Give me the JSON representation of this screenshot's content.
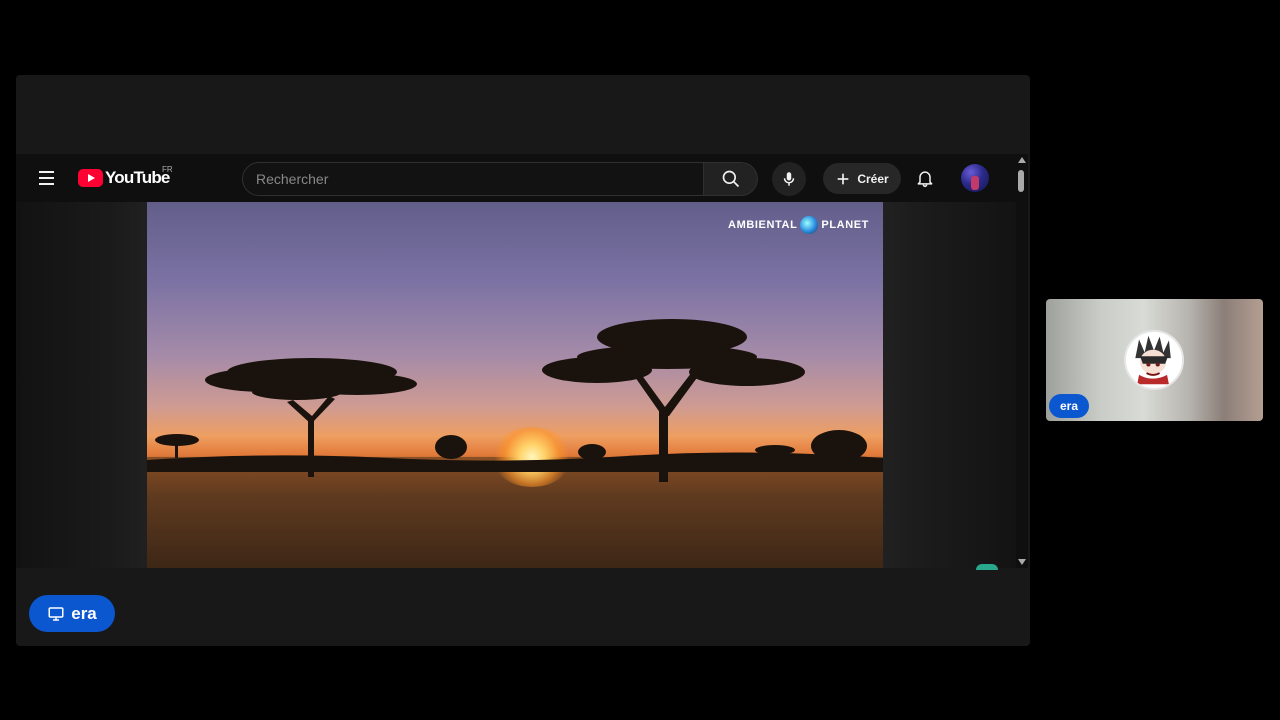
{
  "youtube": {
    "logo_text": "YouTube",
    "region_code": "FR",
    "search": {
      "placeholder": "Rechercher",
      "value": ""
    },
    "create_label": "Créer",
    "icons": {
      "menu": "hamburger-menu-icon",
      "search": "search-icon",
      "mic": "microphone-icon",
      "create": "plus-icon",
      "notifications": "bell-icon"
    },
    "video": {
      "channel_watermark_left": "AMBIENTAL",
      "channel_watermark_right": "PLANET"
    }
  },
  "presenter": {
    "name": "era",
    "icon": "screen-share-icon"
  },
  "participant": {
    "name": "era"
  },
  "colors": {
    "meet_blue": "#0b57d0",
    "youtube_red": "#ff0033",
    "panel_bg": "#181818",
    "youtube_bg": "#0f0f0f"
  }
}
